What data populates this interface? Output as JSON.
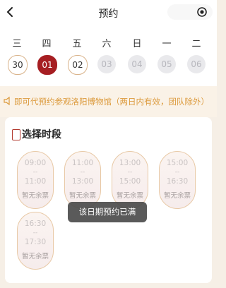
{
  "header": {
    "title": "预约",
    "back_icon": "chevron-left-icon",
    "menu_icon": "target-icon"
  },
  "week": {
    "labels": [
      "三",
      "四",
      "五",
      "六",
      "日",
      "一",
      "二"
    ],
    "dates": [
      "30",
      "01",
      "02",
      "03",
      "04",
      "05",
      "06"
    ],
    "selected": "01"
  },
  "notice": {
    "icon": "speaker-icon",
    "text": "即可代预约参观洛阳博物馆（两日内有效，团队除外）"
  },
  "section": {
    "title": "选择时段",
    "title_icon": "ticket-icon"
  },
  "slots": [
    {
      "start": "09:00",
      "to": "--",
      "end": "11:00",
      "status": "暂无余票"
    },
    {
      "start": "11:00",
      "to": "--",
      "end": "13:00",
      "status": "暂无余票"
    },
    {
      "start": "13:00",
      "to": "--",
      "end": "15:00",
      "status": "暂无余票"
    },
    {
      "start": "15:00",
      "to": "--",
      "end": "16:30",
      "status": "暂无余票"
    },
    {
      "start": "16:30",
      "to": "--",
      "end": "17:30",
      "status": "暂无余票"
    }
  ],
  "toast": "该日期预约已满",
  "colors": {
    "selected": "#a61e22",
    "accent": "#dc9a3c",
    "border": "#d9b38a"
  }
}
